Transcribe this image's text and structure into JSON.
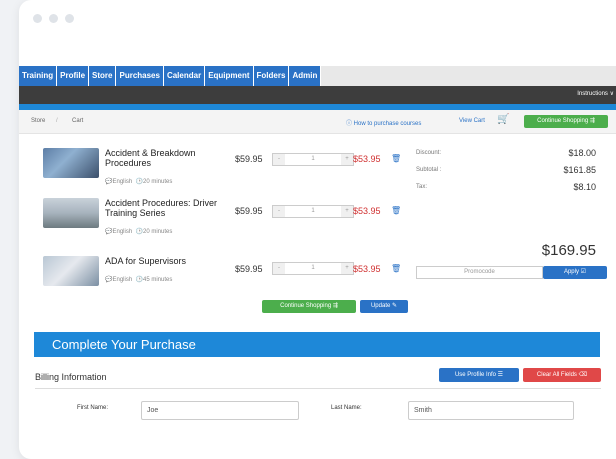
{
  "nav": {
    "tabs": [
      "Training",
      "Profile",
      "Store",
      "Purchases",
      "Calendar",
      "Equipment",
      "Folders",
      "Admin"
    ],
    "instructions": "Instructions ∨"
  },
  "breadcrumb": {
    "store": "Store",
    "separator": "/",
    "cart": "Cart"
  },
  "header_links": {
    "how_to": "ⓘ How to purchase courses",
    "view_cart": "View Cart",
    "continue_shopping": "Continue Shopping ⇶"
  },
  "cart": {
    "items": [
      {
        "name": "Accident & Breakdown Procedures",
        "language": "English",
        "duration": "20 minutes",
        "price": "$59.95",
        "quantity": "1",
        "total": "$53.95"
      },
      {
        "name": "Accident Procedures: Driver Training Series",
        "language": "English",
        "duration": "20 minutes",
        "price": "$59.95",
        "quantity": "1",
        "total": "$53.95"
      },
      {
        "name": "ADA for Supervisors",
        "language": "English",
        "duration": "45 minutes",
        "price": "$59.95",
        "quantity": "1",
        "total": "$53.95"
      }
    ],
    "continue_shopping_label": "Continue Shopping ⇶",
    "update_label": "Update ✎"
  },
  "summary": {
    "discount_label": "Discount:",
    "discount_value": "$18.00",
    "subtotal_label": "Subtotal :",
    "subtotal_value": "$161.85",
    "tax_label": "Tax:",
    "tax_value": "$8.10",
    "total": "$169.95",
    "promo_placeholder": "Promocode",
    "apply_label": "Apply ☑"
  },
  "purchase": {
    "title": "Complete Your Purchase",
    "billing_title": "Billing Information",
    "use_profile_label": "Use Profile Info ☰",
    "clear_fields_label": "Clear All Fields ⌫",
    "first_name_label": "First Name:",
    "first_name_value": "Joe",
    "last_name_label": "Last Name:",
    "last_name_value": "Smith"
  },
  "colors": {
    "tab_blue": "#2a72c6",
    "accent_blue": "#1e88d8",
    "green": "#4cae4c",
    "red": "#e04848",
    "dark_bar": "#3d3d3d"
  }
}
